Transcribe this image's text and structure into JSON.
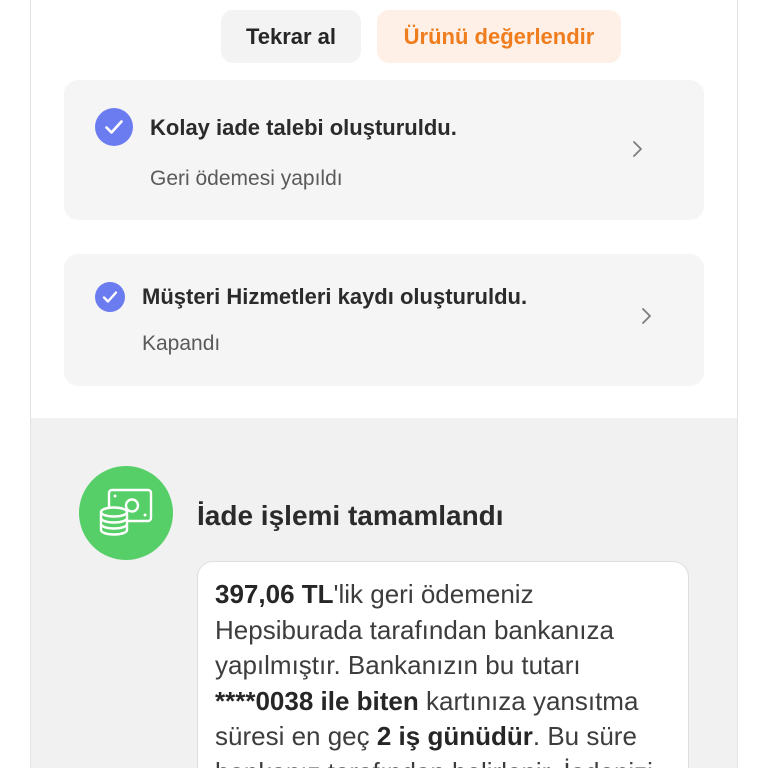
{
  "actions": {
    "reorder": "Tekrar al",
    "review": "Ürünü değerlendir"
  },
  "status_cards": [
    {
      "title": "Kolay iade talebi oluşturuldu.",
      "subtitle": "Geri ödemesi yapıldı",
      "status_icon": "check-circle-icon",
      "action_icon": "chevron-right-icon"
    },
    {
      "title": "Müşteri Hizmetleri kaydı oluşturuldu.",
      "subtitle": "Kapandı",
      "status_icon": "check-circle-icon",
      "action_icon": "chevron-right-icon"
    }
  ],
  "refund": {
    "icon": "money-coins-icon",
    "title": "İade işlemi tamamlandı",
    "message_lines": [
      [
        "397,06 TL",
        "'lik geri ödemeniz"
      ],
      [
        "Hepsiburada tarafından bankanıza"
      ],
      [
        "yapılmıştır. Bankanızın bu tutarı"
      ],
      [
        "****0038 ile biten",
        " kartınıza yansıtma"
      ],
      [
        "süresi en geç ",
        "2 iş günüdür",
        ". Bu süre"
      ],
      [
        "bankanız tarafından belirlenir. İadenizi"
      ]
    ]
  },
  "colors": {
    "accent_orange": "#f07d1d",
    "review_button_bg": "#fef0e6",
    "check_blue": "#6b7cf0",
    "success_green": "#56cf68",
    "card_bg": "#f5f5f5",
    "section_bg": "#f1f1f1"
  }
}
